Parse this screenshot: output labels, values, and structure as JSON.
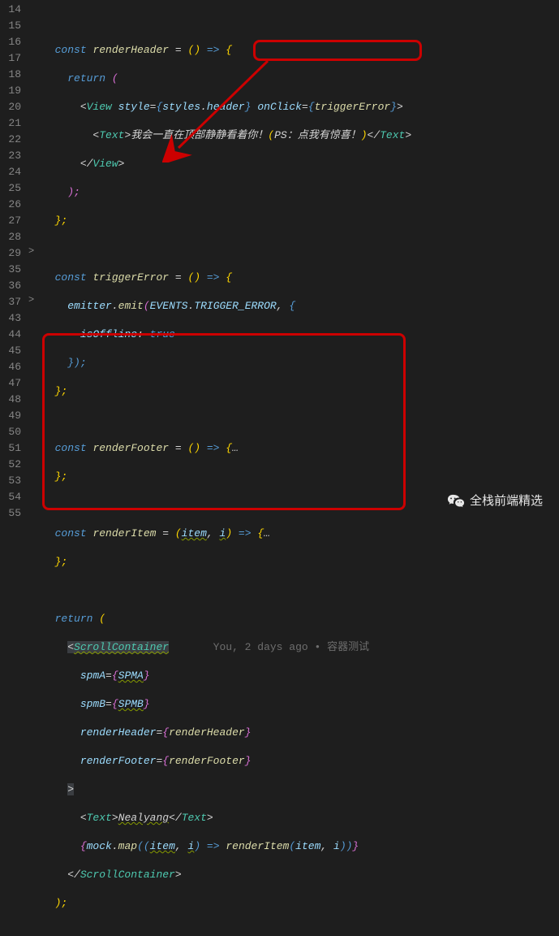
{
  "gutter": [
    "14",
    "15",
    "16",
    "17",
    "18",
    "19",
    "20",
    "21",
    "22",
    "23",
    "24",
    "25",
    "26",
    "27",
    "28",
    "29",
    "35",
    "36",
    "37",
    "43",
    "44",
    "45",
    "46",
    "47",
    "48",
    "49",
    "50",
    "51",
    "52",
    "53",
    "54",
    "55"
  ],
  "folds": {
    "29": ">",
    "37": ">"
  },
  "code": {
    "l15": {
      "const": "const",
      "name": "renderHeader",
      "eq": " = ",
      "arrow": "()",
      "op": " => ",
      "brace": "{"
    },
    "l16": {
      "return": "return",
      "p": " ("
    },
    "l17": {
      "open": "<",
      "view": "View",
      "sp": " ",
      "style": "style",
      "eq": "=",
      "b1": "{",
      "styles": "styles",
      "dot": ".",
      "header": "header",
      "b2": "}",
      "sp2": " ",
      "onclick": "onClick",
      "eq2": "=",
      "b3": "{",
      "trig": "triggerError",
      "b4": "}",
      "close": ">"
    },
    "l18": {
      "open": "<",
      "text": "Text",
      "close": ">",
      "content": "我会一直在顶部静静看着你！",
      "paren1": "(",
      "ps": "PS：点我有惊喜！",
      "paren2": ")",
      "open2": "</",
      "text2": "Text",
      "close2": ">"
    },
    "l19": {
      "close": "</",
      "view": "View",
      "gt": ">"
    },
    "l20": {
      "p": ");"
    },
    "l21": {
      "b": "};"
    },
    "l23": {
      "const": "const",
      "name": "triggerError",
      "eq": " = ",
      "arrow": "()",
      "op": " => ",
      "brace": "{"
    },
    "l24": {
      "emitter": "emitter",
      "dot": ".",
      "emit": "emit",
      "p1": "(",
      "events": "EVENTS",
      "dot2": ".",
      "trig": "TRIGGER_ERROR",
      "comma": ", ",
      "b": "{"
    },
    "l25": {
      "key": "isOffline",
      "colon": ": ",
      "val": "true"
    },
    "l26": {
      "close": "});"
    },
    "l27": {
      "b": "};"
    },
    "l29": {
      "const": "const",
      "name": "renderFooter",
      "eq": " = ",
      "arrow": "()",
      "op": " => ",
      "brace": "{",
      "dots": "…"
    },
    "l35": {
      "b": "};"
    },
    "l37": {
      "const": "const",
      "name": "renderItem",
      "eq": " = ",
      "p1": "(",
      "item": "item",
      "comma": ", ",
      "i": "i",
      "p2": ")",
      "op": " => ",
      "brace": "{",
      "dots": "…"
    },
    "l43": {
      "b": "};"
    },
    "l45": {
      "return": "return",
      "p": " ("
    },
    "l46": {
      "open": "<",
      "comp": "ScrollContainer",
      "lens": "       You, 2 days ago • 容器测试"
    },
    "l47": {
      "prop": "spmA",
      "eq": "=",
      "b1": "{",
      "val": "SPMA",
      "b2": "}"
    },
    "l48": {
      "prop": "spmB",
      "eq": "=",
      "b1": "{",
      "val": "SPMB",
      "b2": "}"
    },
    "l49": {
      "prop": "renderHeader",
      "eq": "=",
      "b1": "{",
      "val": "renderHeader",
      "b2": "}"
    },
    "l50": {
      "prop": "renderFooter",
      "eq": "=",
      "b1": "{",
      "val": "renderFooter",
      "b2": "}"
    },
    "l51": {
      "close": ">"
    },
    "l52": {
      "open": "<",
      "text": "Text",
      "gt": ">",
      "content": "Nealyang",
      "open2": "</",
      "text2": "Text",
      "gt2": ">"
    },
    "l53": {
      "b1": "{",
      "mock": "mock",
      "dot": ".",
      "map": "map",
      "p1": "((",
      "item": "item",
      "comma": ", ",
      "i": "i",
      "p2": ")",
      "op": " => ",
      "fn": "renderItem",
      "p3": "(",
      "item2": "item",
      "comma2": ", ",
      "i2": "i",
      "p4": "))",
      "b2": "}"
    },
    "l54": {
      "close": "</",
      "comp": "ScrollContainer",
      "gt": ">"
    },
    "l55": {
      "p": ");"
    }
  },
  "watermark": "全栈前端精选"
}
